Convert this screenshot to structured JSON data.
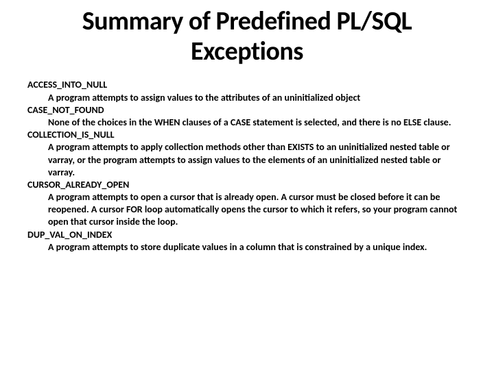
{
  "title": "Summary of Predefined PL/SQL Exceptions",
  "items": [
    {
      "name": "ACCESS_INTO_NULL",
      "desc": "A program attempts to assign values to the attributes of an uninitialized object"
    },
    {
      "name": "CASE_NOT_FOUND",
      "desc": "None of the choices in the WHEN clauses of a CASE statement is selected, and there is no ELSE clause."
    },
    {
      "name": "COLLECTION_IS_NULL",
      "desc": "A program attempts to apply collection methods other than EXISTS to an uninitialized nested table or varray, or the program attempts to assign values to the elements of an uninitialized nested table or varray."
    },
    {
      "name": "CURSOR_ALREADY_OPEN",
      "desc": "A program attempts to open a cursor that is already open. A cursor must be closed before it can be reopened. A cursor FOR loop automatically opens the cursor to which it refers, so your program cannot open that cursor inside the loop."
    },
    {
      "name": "DUP_VAL_ON_INDEX",
      "desc": "A program attempts to store duplicate values in a column that is constrained by a unique index."
    }
  ]
}
